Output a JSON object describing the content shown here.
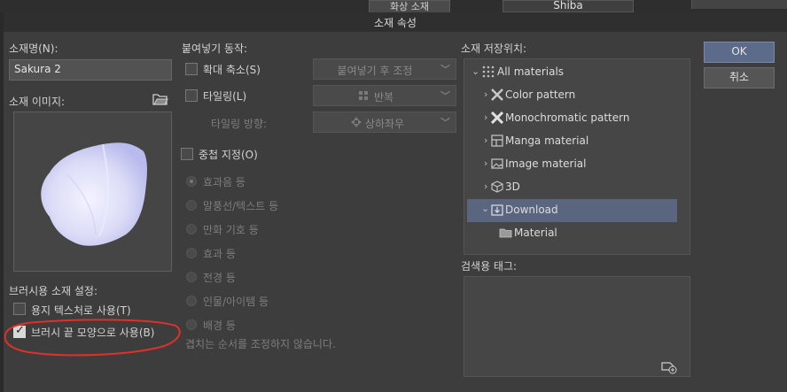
{
  "window": {
    "title": "소재 속성"
  },
  "background": {
    "tab_label": "화상 소재",
    "shiba_label": "Shiba"
  },
  "left": {
    "name_label": "소재명(N):",
    "name_value": "Sakura 2",
    "image_label": "소재 이미지:",
    "brush_section_label": "브러시용 소재 설정:",
    "paper_texture_label": "용지 텍스처로 사용(T)",
    "paper_texture_checked": false,
    "brush_tip_label": "브러시 끝 모양으로 사용(B)",
    "brush_tip_checked": true,
    "highlight_color": "#e0302a"
  },
  "paste": {
    "section_label": "붙여넣기 동작:",
    "scale_label": "확대 축소(S)",
    "scale_select": "붙여넣기 후 조정",
    "tiling_label": "타일링(L)",
    "tiling_select": "반복",
    "tiling_dir_label": "타일링 방향:",
    "tiling_dir_select": "상하좌우"
  },
  "layering": {
    "label": "중첩 지정(O)",
    "options": [
      "효과음 등",
      "말풍선/텍스트 등",
      "만화 기호 등",
      "효과 등",
      "전경 등",
      "인물/아이템 등",
      "배경 등"
    ],
    "hint": "겹치는 순서를 조정하지 않습니다."
  },
  "storage": {
    "label": "소재 저장위치:",
    "items": [
      {
        "label": "All materials",
        "icon": "grid-dots-icon"
      },
      {
        "label": "Color pattern",
        "icon": "color-pattern-icon"
      },
      {
        "label": "Monochromatic pattern",
        "icon": "mono-pattern-icon"
      },
      {
        "label": "Manga material",
        "icon": "manga-material-icon"
      },
      {
        "label": "Image material",
        "icon": "image-material-icon"
      },
      {
        "label": "3D",
        "icon": "cube-icon"
      },
      {
        "label": "Download",
        "icon": "download-folder-icon"
      },
      {
        "label": "Material",
        "icon": "folder-icon"
      }
    ],
    "selected": "Download",
    "selected_color": "#5a6580"
  },
  "tags": {
    "label": "검색용 태그:"
  },
  "buttons": {
    "ok": "OK",
    "cancel": "취소"
  }
}
